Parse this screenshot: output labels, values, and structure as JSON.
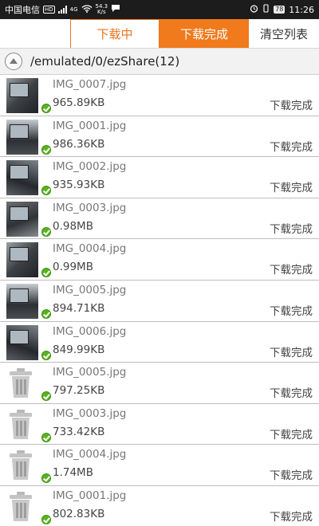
{
  "status_bar": {
    "carrier": "中国电信",
    "hd": "HD",
    "network": "4G",
    "speed_value": "54.3",
    "speed_unit": "K/s",
    "battery": "78",
    "time": "11:26"
  },
  "tabs": {
    "downloading": "下载中",
    "done": "下载完成",
    "clear": "清空列表"
  },
  "path": "/emulated/0/ezShare(12)",
  "files": [
    {
      "name": "IMG_0007.jpg",
      "size": "965.89KB",
      "status": "下载完成",
      "thumb": "photo"
    },
    {
      "name": "IMG_0001.jpg",
      "size": "986.36KB",
      "status": "下载完成",
      "thumb": "photo"
    },
    {
      "name": "IMG_0002.jpg",
      "size": "935.93KB",
      "status": "下载完成",
      "thumb": "photo"
    },
    {
      "name": "IMG_0003.jpg",
      "size": "0.98MB",
      "status": "下载完成",
      "thumb": "photo"
    },
    {
      "name": "IMG_0004.jpg",
      "size": "0.99MB",
      "status": "下载完成",
      "thumb": "photo"
    },
    {
      "name": "IMG_0005.jpg",
      "size": "894.71KB",
      "status": "下载完成",
      "thumb": "photo"
    },
    {
      "name": "IMG_0006.jpg",
      "size": "849.99KB",
      "status": "下载完成",
      "thumb": "photo"
    },
    {
      "name": "IMG_0005.jpg",
      "size": "797.25KB",
      "status": "下载完成",
      "thumb": "trash"
    },
    {
      "name": "IMG_0003.jpg",
      "size": "733.42KB",
      "status": "下载完成",
      "thumb": "trash"
    },
    {
      "name": "IMG_0004.jpg",
      "size": "1.74MB",
      "status": "下载完成",
      "thumb": "trash"
    },
    {
      "name": "IMG_0001.jpg",
      "size": "802.83KB",
      "status": "下载完成",
      "thumb": "trash"
    }
  ],
  "colors": {
    "accent": "#f07a1c",
    "check": "#5bb31e"
  }
}
